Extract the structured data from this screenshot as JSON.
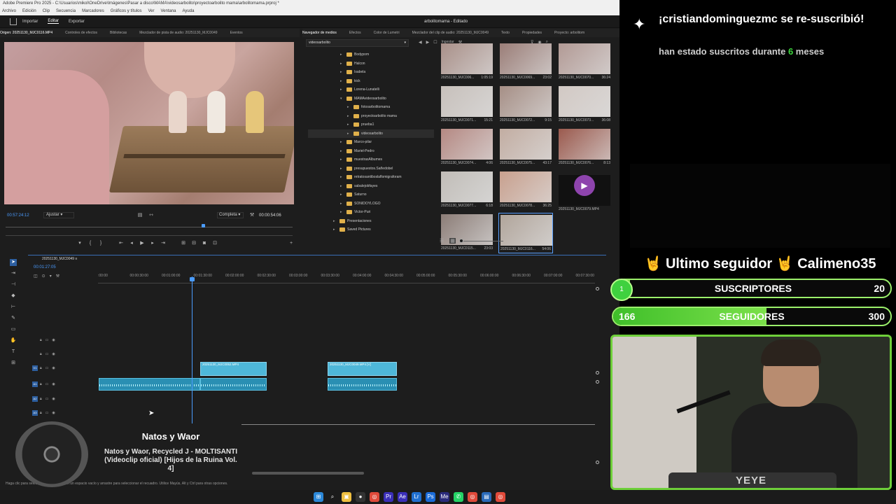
{
  "premiere": {
    "title": "Adobe Premiere Pro 2025 - C:\\Usuarios\\mikol\\OneDrive\\Imágenes\\Pasar a disco\\MAMA\\videosarbolito\\proyectoarbolito mama\\arbolitomama.prproj *",
    "menu": [
      "Archivo",
      "Edición",
      "Clip",
      "Secuencia",
      "Marcadores",
      "Gráficos y títulos",
      "Ver",
      "Ventana",
      "Ayuda"
    ],
    "workspace_tabs": [
      "Importar",
      "Editar",
      "Exportar"
    ],
    "active_tab": "Editar",
    "project_name": "arbolitomama - Editado"
  },
  "source_monitor": {
    "tabs": [
      "Origen: 20251130_MJC0116.MP4",
      "Controles de efectos",
      "Bibliotecas",
      "Mezclador de pista de audio: 20251130_MJC0049",
      "Eventos"
    ],
    "timecode_in": "00:57:24:12",
    "fit": "Ajustar",
    "quality": "Completa",
    "timecode_dur": "00:00:54:06"
  },
  "media_browser": {
    "tabs": [
      "Navegador de medios",
      "Efectos",
      "Color de Lumetri",
      "Mezclador del clip de audio: 20251130_MJC0049",
      "Texto",
      "Propiedades",
      "Proyecto: arbolitom"
    ],
    "location": "videosarbolito",
    "ingest": "Ingestar",
    "tree": [
      {
        "name": "Bodypom",
        "depth": 1,
        "open": false
      },
      {
        "name": "Halcon",
        "depth": 1,
        "open": false
      },
      {
        "name": "Isabela",
        "depth": 1,
        "open": false
      },
      {
        "name": "kick",
        "depth": 1,
        "open": false
      },
      {
        "name": "Lorena-Lunatelli",
        "depth": 1,
        "open": false
      },
      {
        "name": "MAMAvideosarbolito",
        "depth": 1,
        "open": true
      },
      {
        "name": "fotosarbolitomama",
        "depth": 2,
        "open": false
      },
      {
        "name": "proyectoarbolito mama",
        "depth": 2,
        "open": false
      },
      {
        "name": "prueba1",
        "depth": 2,
        "open": false
      },
      {
        "name": "videosarbolito",
        "depth": 2,
        "open": false,
        "selected": true
      },
      {
        "name": "Marco-pilar",
        "depth": 1,
        "open": false
      },
      {
        "name": "Mariel-Pedro",
        "depth": 1,
        "open": false
      },
      {
        "name": "muestrasAlbumes",
        "depth": 1,
        "open": false
      },
      {
        "name": "presupuestos.Sañedobel",
        "depth": 1,
        "open": false
      },
      {
        "name": "retratosantiboslaflomigraforam",
        "depth": 1,
        "open": false
      },
      {
        "name": "sabalejobfayes",
        "depth": 1,
        "open": false
      },
      {
        "name": "Saturno",
        "depth": 1,
        "open": false
      },
      {
        "name": "SONIDOYLOGO",
        "depth": 1,
        "open": false
      },
      {
        "name": "Victor-Puri",
        "depth": 1,
        "open": false
      },
      {
        "name": "Presentaciones",
        "depth": 0,
        "open": false
      },
      {
        "name": "Saved Pictures",
        "depth": 0,
        "open": false
      }
    ],
    "thumbs": [
      {
        "name": "20251130_MJC006...",
        "dur": "1:05:19",
        "color": "#a99089"
      },
      {
        "name": "20251130_MJC0069...",
        "dur": "23:02",
        "color": "#9b7e78"
      },
      {
        "name": "20251130_MJC0070...",
        "dur": "36:24",
        "color": "#b29a95"
      },
      {
        "name": "20251130_MJC0071...",
        "dur": "15:21",
        "color": "#c7c0bb"
      },
      {
        "name": "20251130_MJC0072...",
        "dur": "9:15",
        "color": "#a68f86"
      },
      {
        "name": "20251130_MJC0073...",
        "dur": "36:08",
        "color": "#d2c9c4"
      },
      {
        "name": "20251130_MJC0074...",
        "dur": "4:06",
        "color": "#b58983"
      },
      {
        "name": "20251130_MJC0075...",
        "dur": "43:17",
        "color": "#c2ada2"
      },
      {
        "name": "20251130_MJC0076...",
        "dur": "8:13",
        "color": "#9b5a4e"
      },
      {
        "name": "20251130_MJC0077...",
        "dur": "6:18",
        "color": "#c1bdb8"
      },
      {
        "name": "20251130_MJC0078...",
        "dur": "36:25",
        "color": "#c8a08e"
      },
      {
        "name": "20251130_MJC0079.MP4",
        "dur": "",
        "color": "#111111",
        "audio": true
      },
      {
        "name": "20251130_MJC0115...",
        "dur": "23:03",
        "color": "#8c7d77"
      },
      {
        "name": "20251130_MJC0116...",
        "dur": "54:06",
        "color": "#b1a59b",
        "selected": true
      }
    ]
  },
  "timeline": {
    "sequence": "20251130_MJC0049",
    "timecode": "00:01:27:05",
    "ruler": [
      ":00:00",
      "00:00:30:00",
      "00:01:00:00",
      "00:01:30:00",
      "00:02:00:00",
      "00:02:30:00",
      "00:03:00:00",
      "00:03:30:00",
      "00:04:00:00",
      "00:04:30:00",
      "00:05:00:00",
      "00:05:30:00",
      "00:06:00:00",
      "00:06:30:00",
      "00:07:00:00",
      "00:07:30:00"
    ],
    "tracks": [
      "V3",
      "V2",
      "V1",
      "A1",
      "A2",
      "A3"
    ],
    "clips": [
      {
        "label": "20251130_MJC0052.MP4"
      },
      {
        "label": "20251130_MJC0049.MP4 [V]"
      }
    ],
    "status": "Haga clic para seleccionar o haga clic en un espacio vacío y arrastre para seleccionar el recuadro. Utilice Mayús, Alt y Ctrl para otras opciones."
  },
  "now_playing": {
    "artist": "Natos y Waor",
    "song": "Natos y Waor, Recycled J - MOLTISANTI (Videoclip oficial) [Hijos de la Ruina Vol. 4]"
  },
  "stream": {
    "alert_title": "¡cristiandominguezmc se re-suscribió!",
    "alert_pre": "han estado suscritos durante ",
    "alert_months": "6",
    "alert_post": " meses",
    "last_follower": "🤘 Ultimo seguidor 🤘 Calimeno35",
    "subs_label": "SUSCRIPTORES",
    "subs_goal": "20",
    "subs_count": "1",
    "followers_label": "SEGUIDORES",
    "followers_count": "166",
    "followers_goal": "300",
    "cam_brand": "YEYE",
    "accent": "#6ecf3a"
  },
  "taskbar": {
    "time": "",
    "apps": [
      "windows-icon",
      "search-icon",
      "explorer-icon",
      "obs-icon",
      "chrome-icon",
      "premiere-icon",
      "aftereffects-icon",
      "lightroom-icon",
      "photoshop-icon",
      "mediaencoder-icon",
      "whatsapp-icon",
      "chrome2-icon",
      "store-icon",
      "chrome3-icon"
    ]
  }
}
